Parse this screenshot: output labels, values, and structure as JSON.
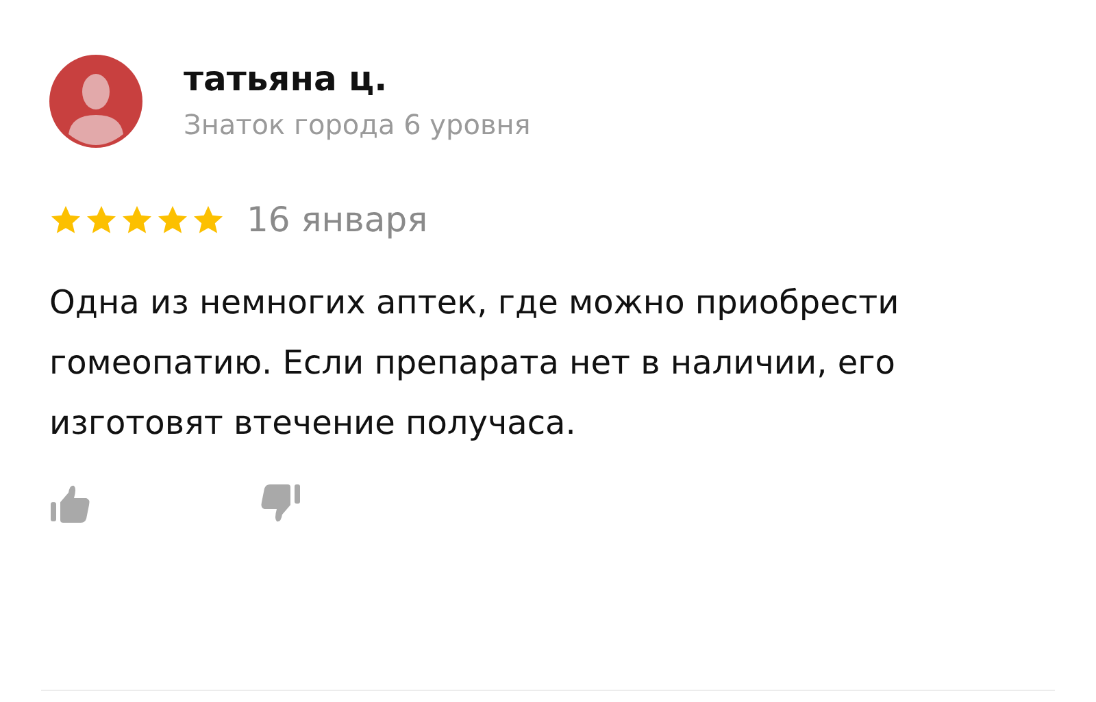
{
  "review": {
    "author": "татьяна ц.",
    "author_level": "Знаток города 6 уровня",
    "stars": 5,
    "date": "16 января",
    "text": "Одна из немногих аптек, где можно приобрести гомеопатию. Если препарата нет в наличии, его изготовят втечение получаса."
  }
}
